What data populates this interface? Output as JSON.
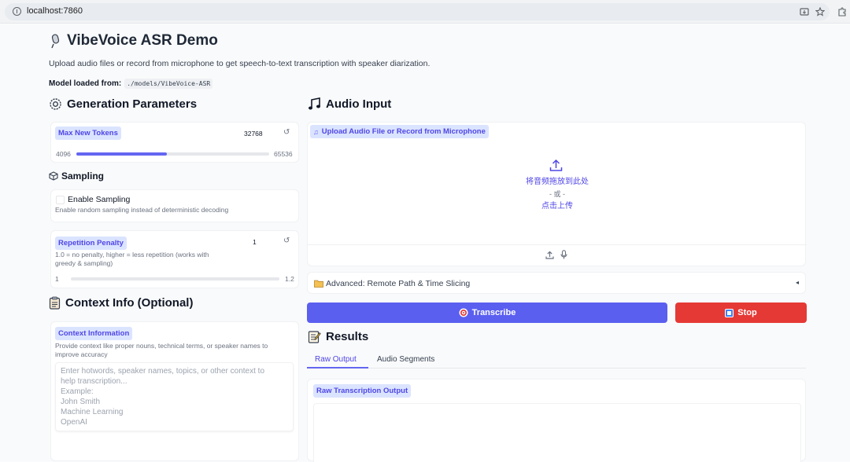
{
  "browser": {
    "url": "localhost:7860"
  },
  "header": {
    "title": "VibeVoice ASR Demo",
    "subtitle": "Upload audio files or record from microphone to get speech-to-text transcription with speaker diarization.",
    "model_label": "Model loaded from:",
    "model_path": "./models/VibeVoice-ASR"
  },
  "generation": {
    "title": "Generation Parameters",
    "max_tokens": {
      "label": "Max New Tokens",
      "value": "32768",
      "min": "4096",
      "max": "65536",
      "level": 0.47
    },
    "sampling_title": "Sampling",
    "enable_sampling": {
      "label": "Enable Sampling",
      "description": "Enable random sampling instead of deterministic decoding",
      "checked": false
    },
    "repetition_penalty": {
      "label": "Repetition Penalty",
      "value": "1",
      "description_line1": "1.0 = no penalty, higher = less repetition (works with",
      "description_line2": "greedy & sampling)",
      "min": "1",
      "max": "1.2",
      "level": 0.0
    }
  },
  "context": {
    "title": "Context Info (Optional)",
    "label": "Context Information",
    "description_line1": "Provide context like proper nouns, technical terms, or speaker names to",
    "description_line2": "improve accuracy",
    "placeholder_lines": [
      "Enter hotwords, speaker names, topics, or other context to",
      "help transcription...",
      "Example:",
      "John Smith",
      "Machine Learning",
      "OpenAI"
    ]
  },
  "audio": {
    "title": "Audio Input",
    "label": "Upload Audio File or Record from Microphone",
    "drop_text": "将音频拖放到此处",
    "or_text": "- 或 -",
    "click_text": "点击上传",
    "advanced_label": "Advanced: Remote Path & Time Slicing"
  },
  "actions": {
    "transcribe": "Transcribe",
    "stop": "Stop"
  },
  "results": {
    "title": "Results",
    "tabs": [
      "Raw Output",
      "Audio Segments"
    ],
    "output_label": "Raw Transcription Output"
  },
  "colors": {
    "accent": "#6366f1",
    "transcribe_button": "#5b5ff0",
    "stop_button": "#e53935",
    "chip_bg": "#dbe4ff"
  }
}
